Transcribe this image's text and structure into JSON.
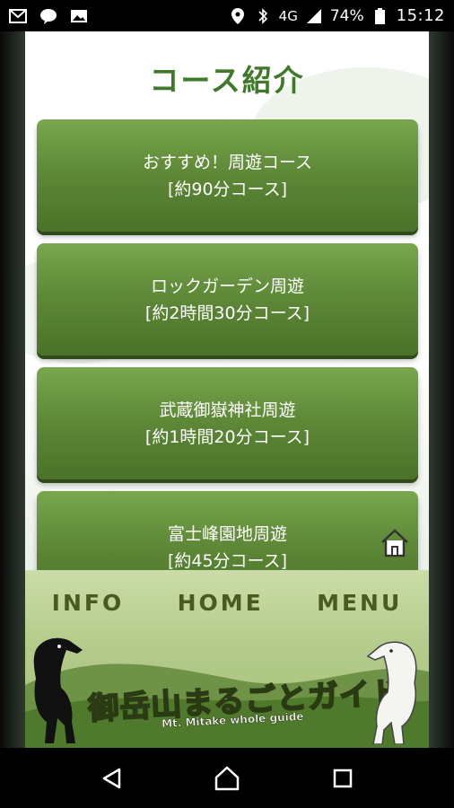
{
  "status_bar": {
    "battery": "74%",
    "network": "4G",
    "time": "15:12"
  },
  "page": {
    "title": "コース紹介"
  },
  "courses": [
    {
      "name": "おすすめ！周遊コース",
      "duration": "[約90分コース]"
    },
    {
      "name": "ロックガーデン周遊",
      "duration": "[約2時間30分コース]"
    },
    {
      "name": "武蔵御嶽神社周遊",
      "duration": "[約1時間20分コース]"
    },
    {
      "name": "富士峰園地周遊",
      "duration": "[約45分コース]"
    }
  ],
  "footer": {
    "nav": [
      "INFO",
      "HOME",
      "MENU"
    ],
    "logo_title": "御岳山まるごとガイド",
    "logo_subtitle": "Mt. Mitake whole guide"
  },
  "icons": {
    "home_float": "home-icon",
    "nav_back": "back-triangle-icon",
    "nav_home": "home-circle-icon",
    "nav_recents": "recents-square-icon"
  },
  "colors": {
    "title": "#3f7a2a",
    "card_top": "#79a64f",
    "card_bottom": "#4a7228",
    "footer_text": "#4c5a1f"
  }
}
